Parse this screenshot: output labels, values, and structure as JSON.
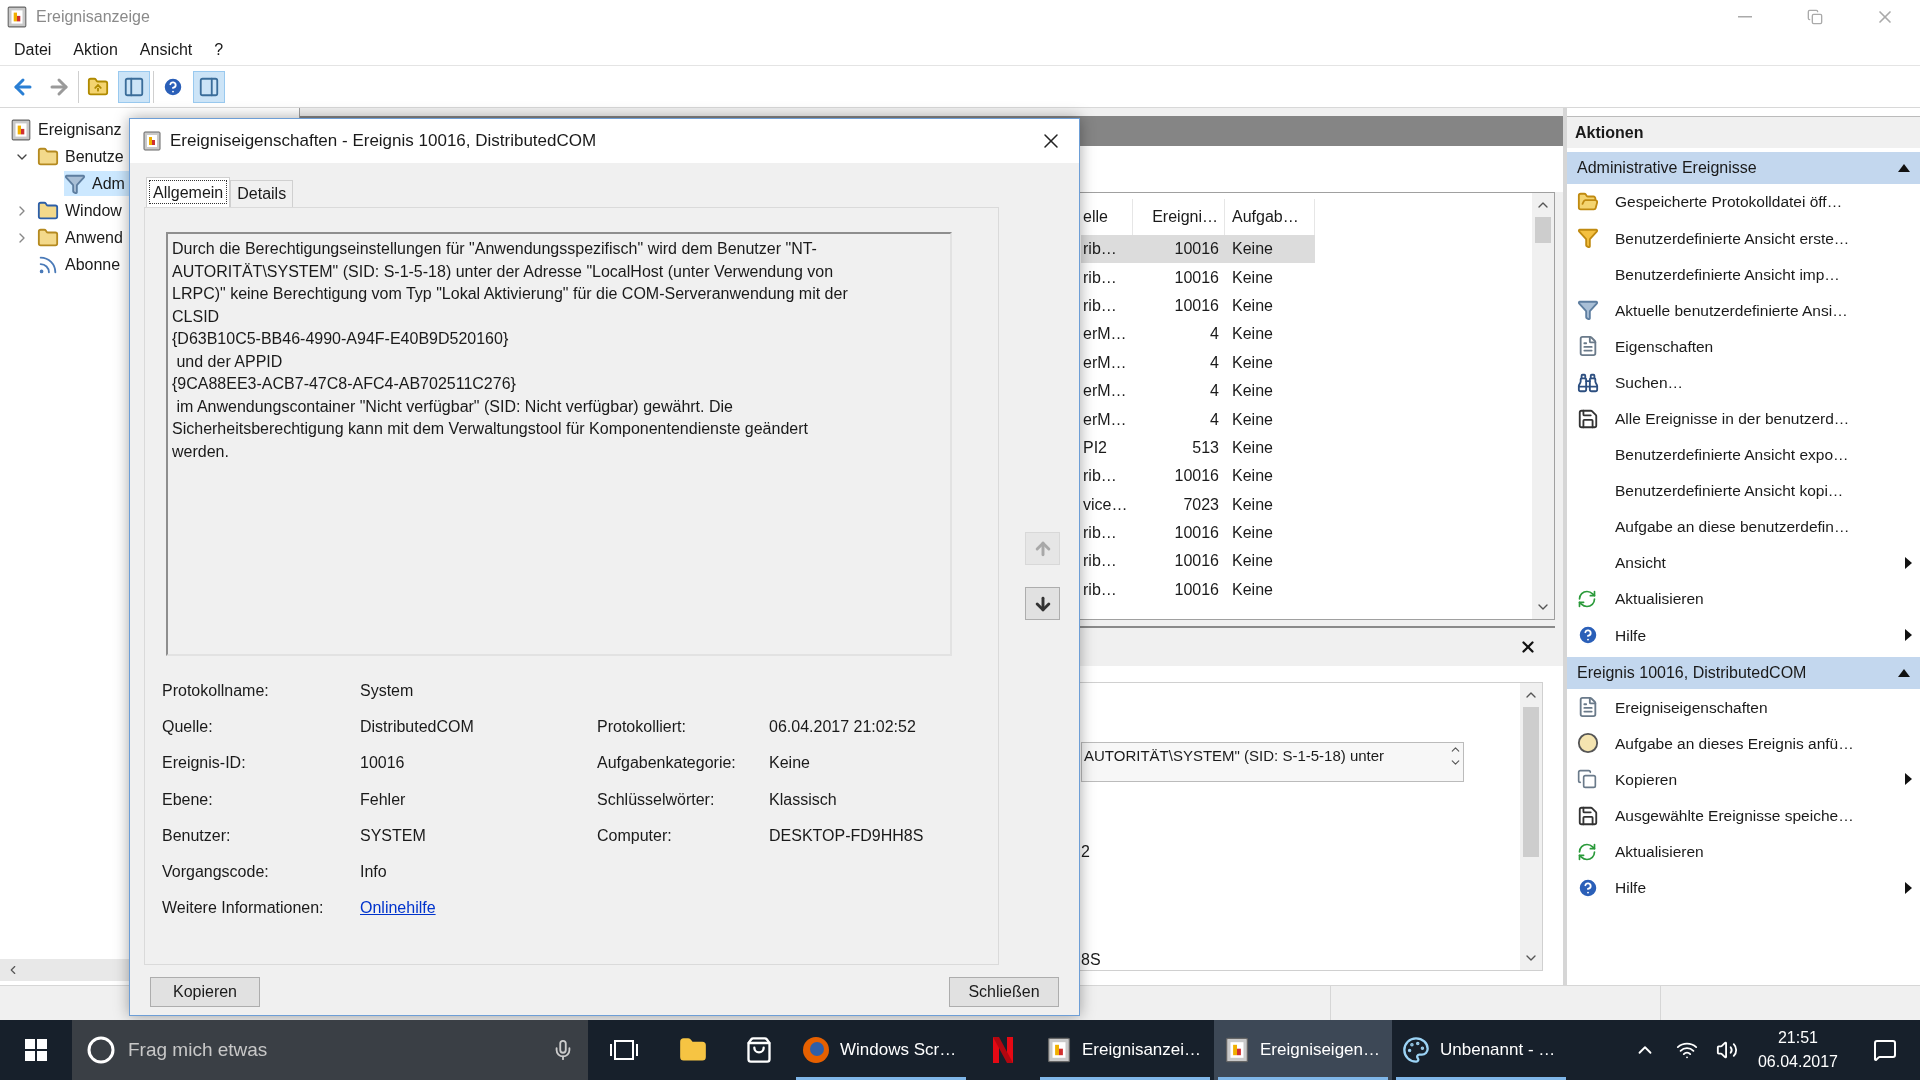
{
  "window": {
    "title": "Ereignisanzeige"
  },
  "menu": [
    "Datei",
    "Aktion",
    "Ansicht",
    "?"
  ],
  "toolbar": {
    "groups": [
      {
        "buttons": [
          {
            "kind": "back",
            "disabled": false,
            "pressed": false
          },
          {
            "kind": "forward",
            "disabled": true,
            "pressed": false
          }
        ]
      },
      {
        "buttons": [
          {
            "kind": "up",
            "pressed": false
          },
          {
            "kind": "tree",
            "pressed": true
          }
        ]
      },
      {
        "buttons": [
          {
            "kind": "help",
            "pressed": false
          },
          {
            "kind": "actions",
            "pressed": true
          }
        ]
      }
    ]
  },
  "tree": [
    {
      "label": "Ereignisanz",
      "kind": "viewer",
      "selected": false,
      "children": [
        {
          "label": "Benutze",
          "kind": "folder",
          "expanded": true,
          "selected": false,
          "children": [
            {
              "label": "Adm",
              "kind": "filter",
              "selected": true
            }
          ]
        },
        {
          "label": "Window",
          "kind": "logs",
          "expanded": false,
          "selected": false
        },
        {
          "label": "Anwend",
          "kind": "folder",
          "expanded": false,
          "selected": false
        },
        {
          "label": "Abonne",
          "kind": "subscriptions",
          "selected": false
        }
      ]
    }
  ],
  "event_list": {
    "columns": [
      "elle",
      "Ereigni…",
      "Aufgab…"
    ],
    "rows": [
      {
        "source": "rib…",
        "id": "10016",
        "task": "Keine",
        "selected": true
      },
      {
        "source": "rib…",
        "id": "10016",
        "task": "Keine",
        "selected": false
      },
      {
        "source": "rib…",
        "id": "10016",
        "task": "Keine",
        "selected": false
      },
      {
        "source": "erM…",
        "id": "4",
        "task": "Keine",
        "selected": false
      },
      {
        "source": "erM…",
        "id": "4",
        "task": "Keine",
        "selected": false
      },
      {
        "source": "erM…",
        "id": "4",
        "task": "Keine",
        "selected": false
      },
      {
        "source": "erM…",
        "id": "4",
        "task": "Keine",
        "selected": false
      },
      {
        "source": "PI2",
        "id": "513",
        "task": "Keine",
        "selected": false
      },
      {
        "source": "rib…",
        "id": "10016",
        "task": "Keine",
        "selected": false
      },
      {
        "source": "vice…",
        "id": "7023",
        "task": "Keine",
        "selected": false
      },
      {
        "source": "rib…",
        "id": "10016",
        "task": "Keine",
        "selected": false
      },
      {
        "source": "rib…",
        "id": "10016",
        "task": "Keine",
        "selected": false
      },
      {
        "source": "rib…",
        "id": "10016",
        "task": "Keine",
        "selected": false
      }
    ]
  },
  "details_pane": {
    "description": "AUTORITÄT\\SYSTEM\" (SID: S-1-5-18) unter",
    "values": [
      "2",
      "8S"
    ]
  },
  "actions": {
    "title": "Aktionen",
    "sections": [
      {
        "title": "Administrative Ereignisse",
        "expanded": true,
        "items": [
          {
            "label": "Gespeicherte Protokolldatei öff…",
            "kind": "open",
            "submenu": false
          },
          {
            "label": "Benutzerdefinierte Ansicht erste…",
            "kind": "create",
            "submenu": false
          },
          {
            "label": "Benutzerdefinierte Ansicht imp…",
            "kind": "plain",
            "submenu": false
          },
          {
            "label": "Aktuelle benutzerdefinierte Ansi…",
            "kind": "filter",
            "submenu": false
          },
          {
            "label": "Eigenschaften",
            "kind": "properties",
            "submenu": false
          },
          {
            "label": "Suchen…",
            "kind": "search",
            "submenu": false
          },
          {
            "label": "Alle Ereignisse in der benutzerd…",
            "kind": "save",
            "submenu": false
          },
          {
            "label": "Benutzerdefinierte Ansicht expo…",
            "kind": "plain",
            "submenu": false
          },
          {
            "label": "Benutzerdefinierte Ansicht kopi…",
            "kind": "plain",
            "submenu": false
          },
          {
            "label": "Aufgabe an diese benutzerdefin…",
            "kind": "plain",
            "submenu": false
          },
          {
            "label": "Ansicht",
            "kind": "plain",
            "submenu": true
          },
          {
            "label": "Aktualisieren",
            "kind": "refresh",
            "submenu": false
          },
          {
            "label": "Hilfe",
            "kind": "help",
            "submenu": true
          }
        ]
      },
      {
        "title": "Ereignis 10016, DistributedCOM",
        "expanded": true,
        "items": [
          {
            "label": "Ereigniseigenschaften",
            "kind": "properties",
            "submenu": false
          },
          {
            "label": "Aufgabe an dieses Ereignis anfü…",
            "kind": "task",
            "submenu": false
          },
          {
            "label": "Kopieren",
            "kind": "copy",
            "submenu": true
          },
          {
            "label": "Ausgewählte Ereignisse speiche…",
            "kind": "save",
            "submenu": false
          },
          {
            "label": "Aktualisieren",
            "kind": "refresh",
            "submenu": false
          },
          {
            "label": "Hilfe",
            "kind": "help",
            "submenu": true
          }
        ]
      }
    ]
  },
  "dialog": {
    "title": "Ereigniseigenschaften - Ereignis 10016, DistributedCOM",
    "tabs": [
      {
        "label": "Allgemein",
        "selected": true
      },
      {
        "label": "Details",
        "selected": false
      }
    ],
    "description": "Durch die Berechtigungseinstellungen für \"Anwendungsspezifisch\" wird dem Benutzer \"NT-\nAUTORITÄT\\SYSTEM\" (SID: S-1-5-18) unter der Adresse \"LocalHost (unter Verwendung von\nLRPC)\" keine Berechtigung vom Typ \"Lokal Aktivierung\" für die COM-Serveranwendung mit der\nCLSID\n{D63B10C5-BB46-4990-A94F-E40B9D520160}\n und der APPID\n{9CA88EE3-ACB7-47C8-AFC4-AB702511C276}\n im Anwendungscontainer \"Nicht verfügbar\" (SID: Nicht verfügbar) gewährt. Die\nSicherheitsberechtigung kann mit dem Verwaltungstool für Komponentendienste geändert\nwerden.",
    "nav_buttons": [
      {
        "disabled": true
      },
      {
        "disabled": false
      }
    ],
    "details": [
      [
        {
          "label": "Protokollname:",
          "value": "System"
        }
      ],
      [
        {
          "label": "Quelle:",
          "value": "DistributedCOM"
        },
        {
          "label": "Protokolliert:",
          "value": "06.04.2017 21:02:52"
        }
      ],
      [
        {
          "label": "Ereignis-ID:",
          "value": "10016"
        },
        {
          "label": "Aufgabenkategorie:",
          "value": "Keine"
        }
      ],
      [
        {
          "label": "Ebene:",
          "value": "Fehler"
        },
        {
          "label": "Schlüsselwörter:",
          "value": "Klassisch"
        }
      ],
      [
        {
          "label": "Benutzer:",
          "value": "SYSTEM"
        },
        {
          "label": "Computer:",
          "value": "DESKTOP-FD9HH8S"
        }
      ],
      [
        {
          "label": "Vorgangscode:",
          "value": "Info"
        }
      ],
      [
        {
          "label": "Weitere Informationen:",
          "link": "Onlinehilfe"
        }
      ]
    ],
    "buttons": [
      "Kopieren",
      "Schließen"
    ]
  },
  "taskbar": {
    "search_placeholder": "Frag mich etwas",
    "apps": [
      {
        "kind": "explorer",
        "running": false,
        "selected": false
      },
      {
        "kind": "store",
        "running": false,
        "selected": false
      },
      {
        "kind": "browser",
        "label": "Windows Scr…",
        "running": true,
        "selected": false
      },
      {
        "kind": "video",
        "running": false,
        "selected": false
      },
      {
        "kind": "viewer",
        "label": "Ereignisanzei…",
        "running": true,
        "selected": false
      },
      {
        "kind": "viewer",
        "label": "Ereigniseigen…",
        "running": true,
        "selected": true
      },
      {
        "kind": "paint",
        "label": "Unbenannt - …",
        "running": true,
        "selected": false
      }
    ],
    "time": "21:51",
    "date": "06.04.2017"
  }
}
